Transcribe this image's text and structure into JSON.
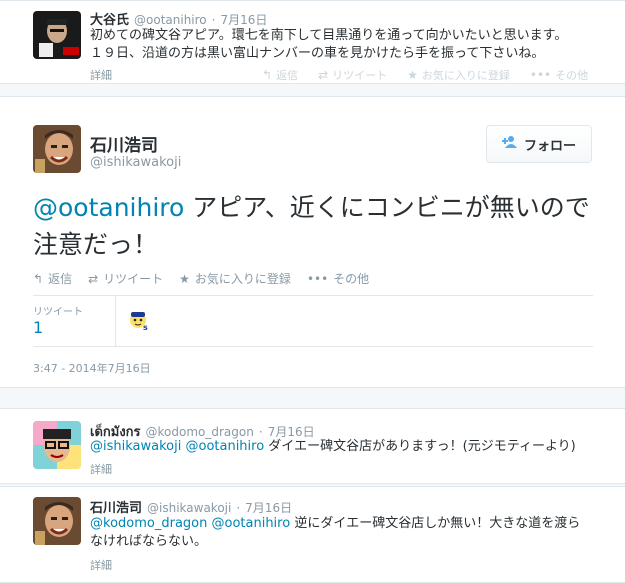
{
  "top_tweet": {
    "name": "大谷氏",
    "handle": "@ootanihiro",
    "date": "7月16日",
    "text_line1": "初めての碑文谷アピア。環七を南下して目黒通りを通って向かいたいと思います。",
    "text_line2": "１９日、沿道の方は黒い富山ナンバーの車を見かけたら手を振って下さいね。",
    "detail": "詳細",
    "actions": {
      "reply": "返信",
      "retweet": "リツイート",
      "favorite": "お気に入りに登録",
      "more": "その他"
    }
  },
  "main_tweet": {
    "name": "石川浩司",
    "handle": "@ishikawakoji",
    "follow_label": "フォロー",
    "mention": "@ootanihiro",
    "text": " アピア、近くにコンビニが無いので注意だっ！",
    "actions": {
      "reply": "返信",
      "retweet": "リツイート",
      "favorite": "お気に入りに登録",
      "more": "その他"
    },
    "retweet_label": "リツイート",
    "retweet_count": "1",
    "timestamp": "3:47 - 2014年7月16日"
  },
  "reply1": {
    "name": "เด็กมังกร",
    "handle": "@kodomo_dragon",
    "date": "7月16日",
    "mention1": "@ishikawakoji",
    "mention2": "@ootanihiro",
    "text": " ダイエー碑文谷店がありますっ！(元ジモティーより)",
    "detail": "詳細"
  },
  "reply2": {
    "name": "石川浩司",
    "handle": "@ishikawakoji",
    "date": "7月16日",
    "mention1": "@kodomo_dragon",
    "mention2": "@ootanihiro",
    "text_line1": " 逆にダイエー碑文谷店しか無い！大きな道を渡ら",
    "text_line2": "なければならない。",
    "detail": "詳細"
  },
  "colors": {
    "link": "#0084b4",
    "accent": "#55acee",
    "muted": "#8899a6"
  }
}
